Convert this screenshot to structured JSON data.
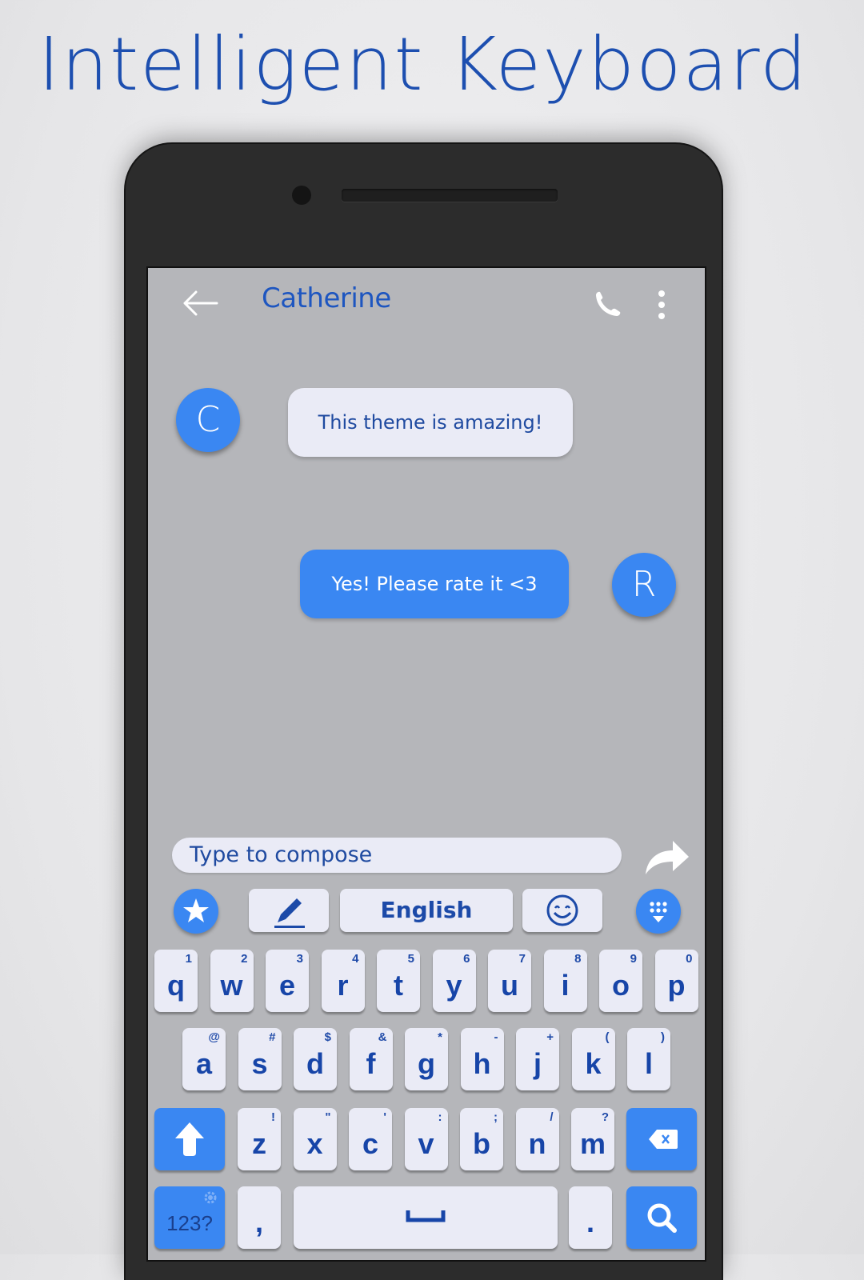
{
  "promo": {
    "title": "Intelligent Keyboard"
  },
  "appbar": {
    "contact_name": "Catherine",
    "back_icon": "arrow-left-icon",
    "call_icon": "phone-icon",
    "menu_icon": "more-vertical-icon"
  },
  "messages": [
    {
      "sender_initial": "C",
      "text": "This theme is amazing!",
      "direction": "incoming"
    },
    {
      "sender_initial": "R",
      "text": "Yes! Please rate it <3",
      "direction": "outgoing"
    }
  ],
  "compose": {
    "placeholder": "Type to compose",
    "send_icon": "share-arrow-icon"
  },
  "toolbar": {
    "star_icon": "star-icon",
    "edit_icon": "pencil-icon",
    "language_label": "English",
    "emoji_icon": "smiley-icon",
    "hide_icon": "keyboard-hide-icon"
  },
  "keyboard": {
    "row1": [
      {
        "key": "q",
        "hint": "1"
      },
      {
        "key": "w",
        "hint": "2"
      },
      {
        "key": "e",
        "hint": "3"
      },
      {
        "key": "r",
        "hint": "4"
      },
      {
        "key": "t",
        "hint": "5"
      },
      {
        "key": "y",
        "hint": "6"
      },
      {
        "key": "u",
        "hint": "7"
      },
      {
        "key": "i",
        "hint": "8"
      },
      {
        "key": "o",
        "hint": "9"
      },
      {
        "key": "p",
        "hint": "0"
      }
    ],
    "row2": [
      {
        "key": "a",
        "hint": "@"
      },
      {
        "key": "s",
        "hint": "#"
      },
      {
        "key": "d",
        "hint": "$"
      },
      {
        "key": "f",
        "hint": "&"
      },
      {
        "key": "g",
        "hint": "*"
      },
      {
        "key": "h",
        "hint": "-"
      },
      {
        "key": "j",
        "hint": "+"
      },
      {
        "key": "k",
        "hint": "("
      },
      {
        "key": "l",
        "hint": ")"
      }
    ],
    "row3": [
      {
        "key": "z",
        "hint": "!"
      },
      {
        "key": "x",
        "hint": "\""
      },
      {
        "key": "c",
        "hint": "'"
      },
      {
        "key": "v",
        "hint": ":"
      },
      {
        "key": "b",
        "hint": ";"
      },
      {
        "key": "n",
        "hint": "/"
      },
      {
        "key": "m",
        "hint": "?"
      }
    ],
    "row4": {
      "symbols_label": "123?",
      "comma": ",",
      "period": "."
    },
    "colors": {
      "accent": "#3a87f2",
      "key_bg": "#eaebf6",
      "key_text": "#1745a8",
      "screen_bg": "#b5b6ba"
    }
  }
}
